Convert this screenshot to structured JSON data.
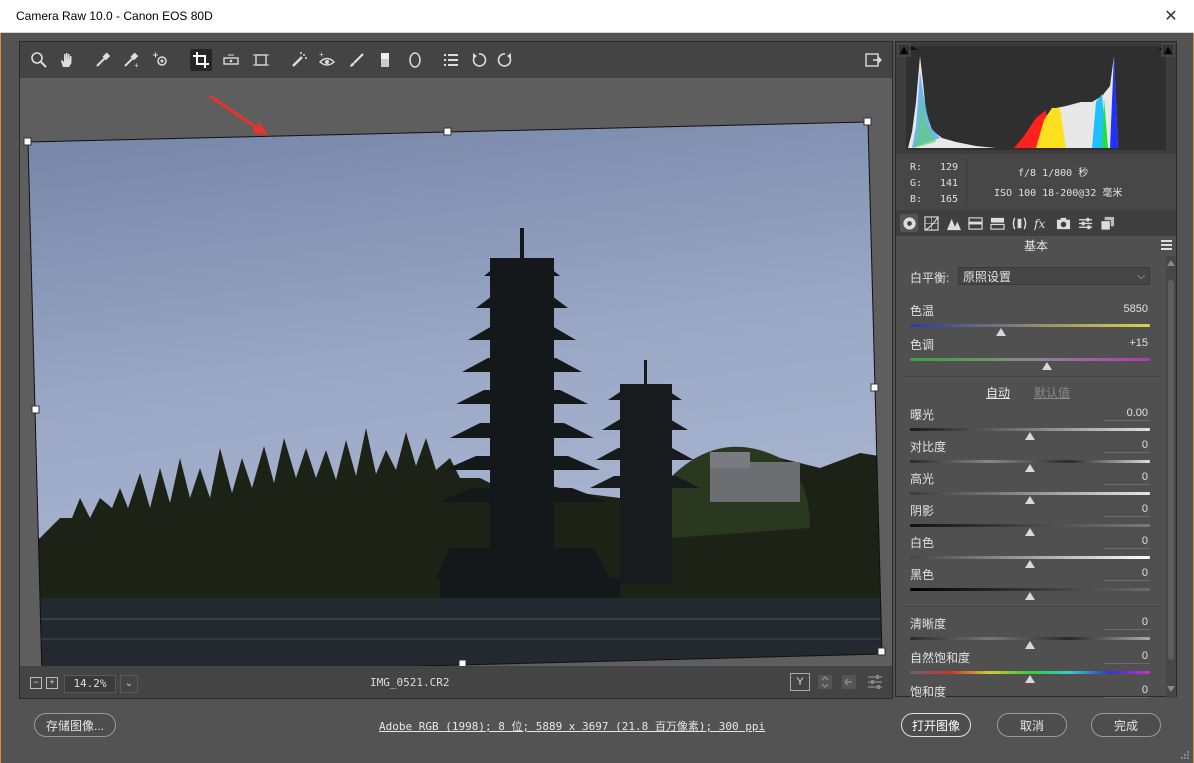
{
  "window": {
    "title": "Camera Raw 10.0 -  Canon EOS 80D",
    "close_glyph": "✕"
  },
  "toolbar": {
    "tools": [
      "zoom-icon",
      "hand-icon",
      "white-balance-icon",
      "color-sampler-icon",
      "targeted-adjust-icon",
      "crop-icon",
      "straighten-icon",
      "transform-icon",
      "spot-removal-icon",
      "red-eye-icon",
      "adjustment-brush-icon",
      "graduated-filter-icon",
      "radial-filter-icon",
      "presets-icon",
      "rotate-left-icon",
      "rotate-right-icon"
    ],
    "active_tool": "crop-icon",
    "fullscreen_icon": "fullscreen-toggle-icon"
  },
  "status": {
    "zoom_minus": "−",
    "zoom_plus": "+",
    "zoom": "14.2%",
    "zoom_dropdown": "⌄",
    "filename": "IMG_0521.CR2",
    "view_btn": "Y"
  },
  "readout": {
    "r_label": "R:",
    "r": "129",
    "g_label": "G:",
    "g": "141",
    "b_label": "B:",
    "b": "165",
    "aperture_shutter": "f/8  1/800 秒",
    "iso_lens": "ISO 100  18-200@32 毫米"
  },
  "panel": {
    "section_title": "基本",
    "wb_label": "白平衡:",
    "wb_value": "原照设置",
    "auto": "自动",
    "defaults": "默认值",
    "sliders": [
      {
        "label": "色温",
        "value": "5850",
        "pos": 0.38
      },
      {
        "label": "色调",
        "value": "+15",
        "pos": 0.57
      },
      {
        "label": "曝光",
        "value": "0.00",
        "pos": 0.5
      },
      {
        "label": "对比度",
        "value": "0",
        "pos": 0.5
      },
      {
        "label": "高光",
        "value": "0",
        "pos": 0.5
      },
      {
        "label": "阴影",
        "value": "0",
        "pos": 0.5
      },
      {
        "label": "白色",
        "value": "0",
        "pos": 0.5
      },
      {
        "label": "黑色",
        "value": "0",
        "pos": 0.5
      },
      {
        "label": "清晰度",
        "value": "0",
        "pos": 0.5
      },
      {
        "label": "自然饱和度",
        "value": "0",
        "pos": 0.5
      },
      {
        "label": "饱和度",
        "value": "0",
        "pos": 0.5
      }
    ]
  },
  "footer": {
    "save": "存储图像...",
    "workflow": "Adobe RGB (1998); 8 位; 5889 x 3697 (21.8 百万像素); 300 ppi",
    "open": "打开图像",
    "cancel": "取消",
    "done": "完成"
  },
  "colors": {
    "accent_border": "#e2863a",
    "annotation_arrow": "#e8322b",
    "sky": "#8e9cbc"
  }
}
